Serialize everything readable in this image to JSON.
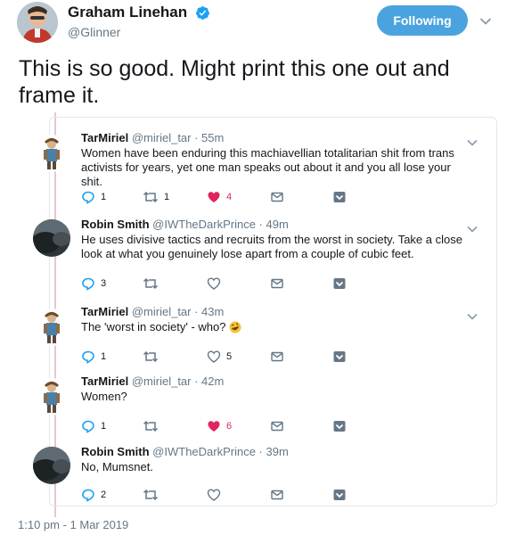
{
  "author": {
    "display_name": "Graham Linehan",
    "handle": "@Glinner",
    "follow_label": "Following"
  },
  "tweet": {
    "text": "This is so good. Might print this one out and frame it.",
    "timestamp": "1:10 pm - 1 Mar 2019"
  },
  "replies": [
    {
      "name": "TarMiriel",
      "handle_time": "@miriel_tar · 55m",
      "text": "Women have been enduring this machiavellian totalitarian shit from trans activists for years, yet one man speaks out about it and you all lose your shit.",
      "replies": "1",
      "retweets": "1",
      "likes": "4",
      "liked": true
    },
    {
      "name": "Robin Smith",
      "handle_time": "@IWTheDarkPrince · 49m",
      "text": "He uses divisive tactics and recruits from the worst in society. Take a close look at what you genuinely lose apart from a couple of cubic feet.",
      "replies": "3",
      "retweets": "",
      "likes": "",
      "liked": false
    },
    {
      "name": "TarMiriel",
      "handle_time": "@miriel_tar · 43m",
      "text": "The 'worst in society' - who?",
      "replies": "1",
      "retweets": "",
      "likes": "5",
      "liked": false
    },
    {
      "name": "TarMiriel",
      "handle_time": "@miriel_tar · 42m",
      "text": "Women?",
      "replies": "1",
      "retweets": "",
      "likes": "6",
      "liked": true
    },
    {
      "name": "Robin Smith",
      "handle_time": "@IWTheDarkPrince · 39m",
      "text": "No, Mumsnet.",
      "replies": "2",
      "retweets": "",
      "likes": "",
      "liked": false
    }
  ],
  "icons": {
    "verified": "verified-badge-icon",
    "caret": "chevron-down-icon",
    "reply": "reply-icon",
    "retweet": "retweet-icon",
    "like": "heart-icon",
    "dm": "envelope-icon",
    "mod": "hide-reply-icon"
  },
  "colors": {
    "accent": "#4aa3df",
    "like": "#e0245e",
    "secondary_text": "#657786",
    "thread_line": "#e6c6d2"
  }
}
